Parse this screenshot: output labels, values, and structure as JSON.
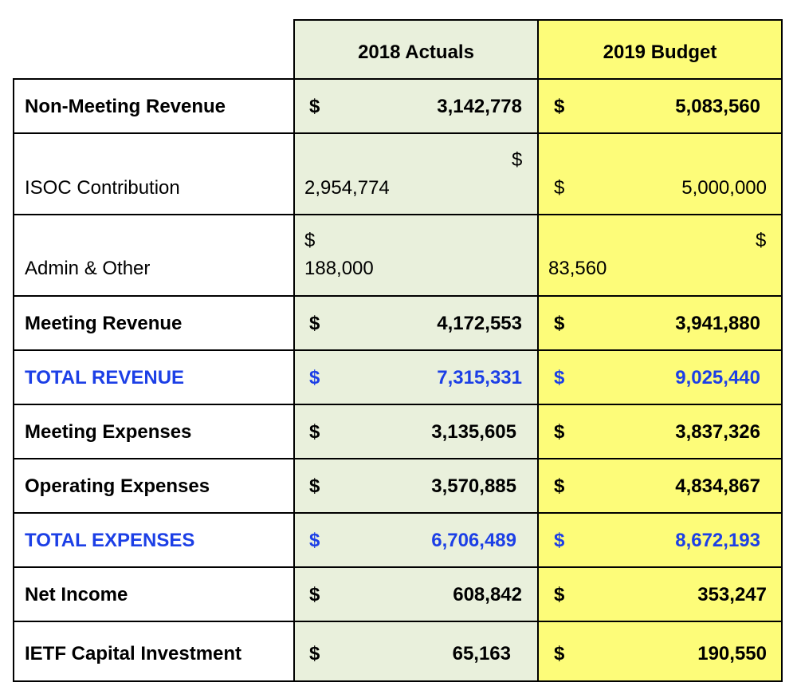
{
  "header": {
    "col1": "2018 Actuals",
    "col2": "2019 Budget"
  },
  "rows": [
    {
      "label": "Non-Meeting Revenue",
      "bold": true,
      "blue": false,
      "a_sym": "$",
      "a_val": "3,142,778",
      "b_sym": "$",
      "b_val": "5,083,560"
    },
    {
      "label": "ISOC Contribution",
      "bold": false,
      "blue": false,
      "a_sym": "$",
      "a_val": "2,954,774",
      "b_sym": "$",
      "b_val": "5,000,000"
    },
    {
      "label": "Admin & Other",
      "bold": false,
      "blue": false,
      "a_sym": "$",
      "a_val": "188,000",
      "b_sym": "$",
      "b_val": "83,560"
    },
    {
      "label": "Meeting Revenue",
      "bold": true,
      "blue": false,
      "a_sym": "$",
      "a_val": "4,172,553",
      "b_sym": "$",
      "b_val": "3,941,880"
    },
    {
      "label": "TOTAL REVENUE",
      "bold": true,
      "blue": true,
      "a_sym": "$",
      "a_val": "7,315,331",
      "b_sym": "$",
      "b_val": "9,025,440"
    },
    {
      "label": "Meeting Expenses",
      "bold": true,
      "blue": false,
      "a_sym": "$",
      "a_val": "3,135,605",
      "b_sym": "$",
      "b_val": "3,837,326"
    },
    {
      "label": "Operating Expenses",
      "bold": true,
      "blue": false,
      "a_sym": "$",
      "a_val": "3,570,885",
      "b_sym": "$",
      "b_val": "4,834,867"
    },
    {
      "label": "TOTAL EXPENSES",
      "bold": true,
      "blue": true,
      "a_sym": "$",
      "a_val": "6,706,489",
      "b_sym": "$",
      "b_val": "8,672,193"
    },
    {
      "label": "Net Income",
      "bold": true,
      "blue": false,
      "a_sym": "$",
      "a_val": "608,842",
      "b_sym": "$",
      "b_val": "353,247"
    },
    {
      "label": "IETF Capital Investment",
      "bold": true,
      "blue": false,
      "a_sym": "$",
      "a_val": "65,163",
      "b_sym": "$",
      "b_val": "190,550"
    }
  ],
  "colors": {
    "actuals_bg": "#e9f0dc",
    "budget_bg": "#fdfc79",
    "total_text": "#1c3fe6",
    "border": "#000000"
  }
}
